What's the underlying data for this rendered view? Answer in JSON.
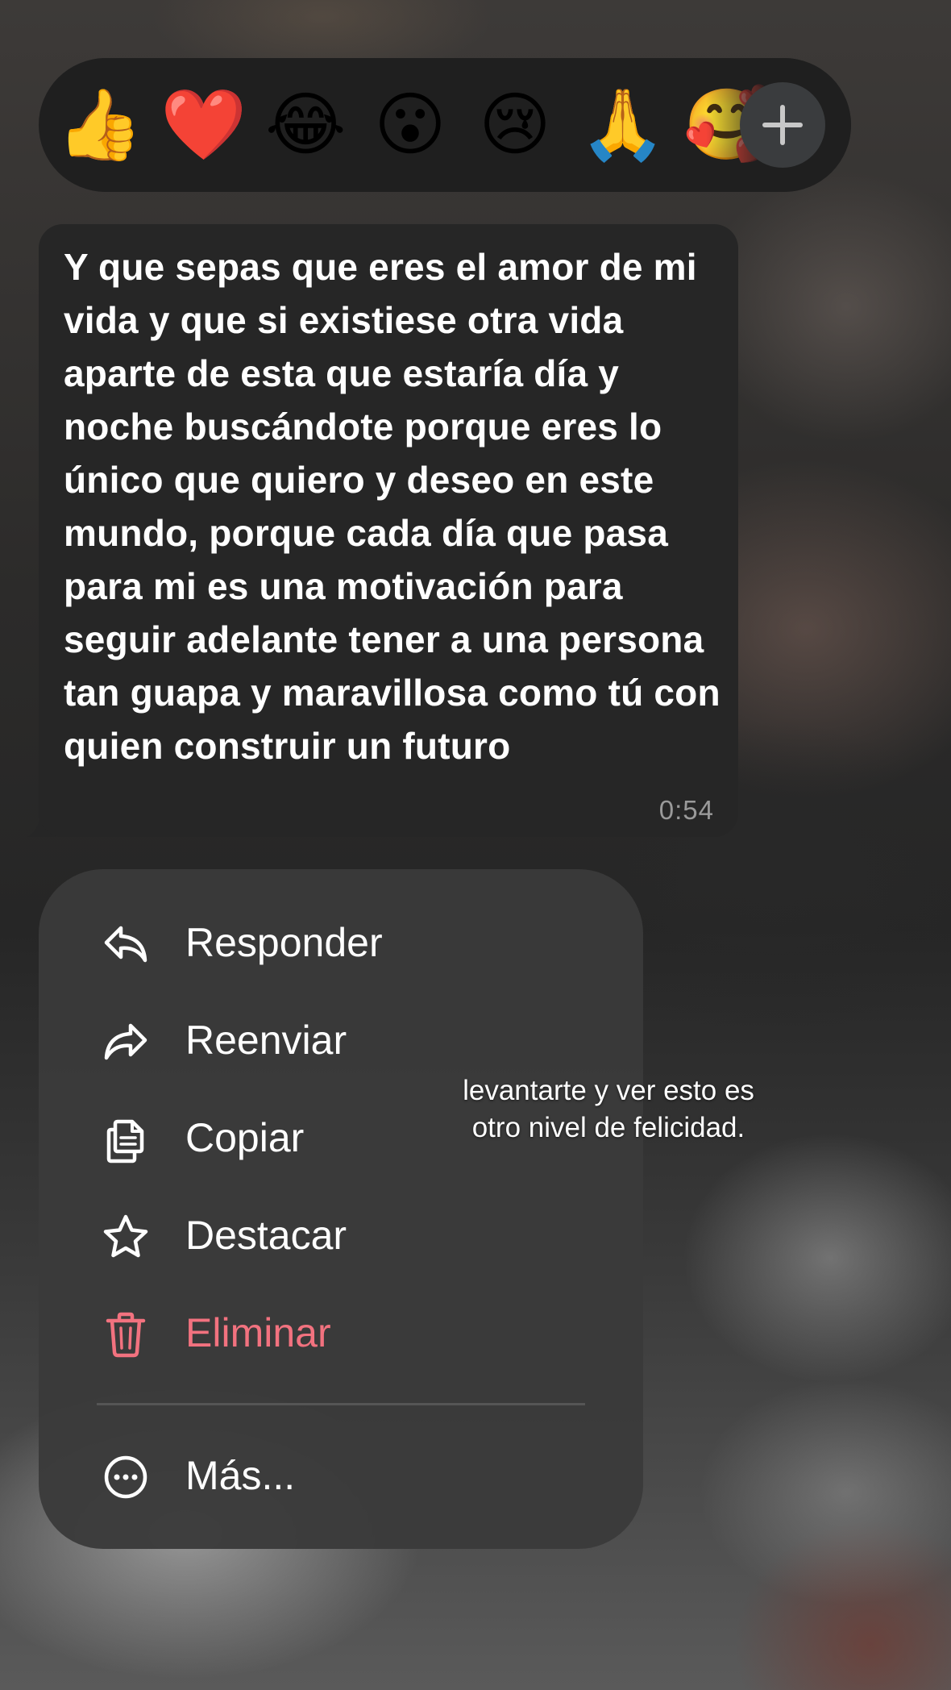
{
  "reactions": {
    "emojis": [
      "👍",
      "❤️",
      "😂",
      "😮",
      "😢",
      "🙏",
      "🥰"
    ],
    "more_icon": "plus-icon"
  },
  "message": {
    "text": "Y que sepas que eres el amor de mi vida y que si existiese otra vida aparte de esta que estaría día y noche buscándote porque eres lo único que quiero y deseo en este mundo, porque cada día que pasa para mi es una motivación para seguir adelante tener a una persona tan guapa y maravillosa como tú con quien construir un futuro",
    "time": "0:54"
  },
  "menu": {
    "reply": "Responder",
    "forward": "Reenviar",
    "copy": "Copiar",
    "star": "Destacar",
    "delete": "Eliminar",
    "more": "Más..."
  },
  "overlay": {
    "line1": "levantarte y ver esto es",
    "line2": "otro nivel de felicidad."
  },
  "colors": {
    "bubble": "#262626",
    "menu": "#3a3a3a",
    "danger": "#f2727f"
  }
}
